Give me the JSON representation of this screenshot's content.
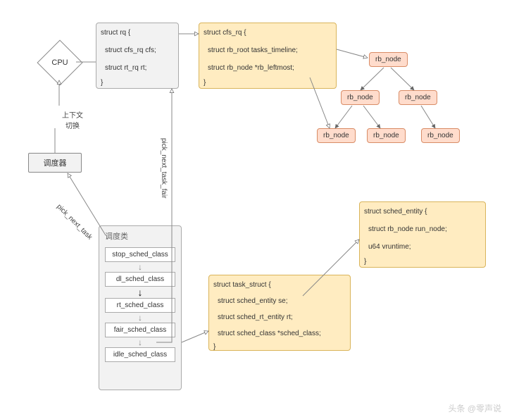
{
  "cpu": {
    "label": "CPU"
  },
  "context_switch": "上下文\n切换",
  "scheduler": {
    "label": "调度器"
  },
  "rq": {
    "open": "struct rq {",
    "l1": "struct cfs_rq cfs;",
    "l2": "struct rt_rq rt;",
    "close": "}"
  },
  "cfs_rq": {
    "open": "struct cfs_rq {",
    "l1": "struct rb_root tasks_timeline;",
    "l2": "struct rb_node *rb_leftmost;",
    "close": "}"
  },
  "rb_nodes": {
    "n1": "rb_node",
    "n2": "rb_node",
    "n3": "rb_node",
    "n4": "rb_node",
    "n5": "rb_node",
    "n6": "rb_node"
  },
  "sched_entity": {
    "open": "struct sched_entity {",
    "l1": "struct rb_node run_node;",
    "l2": "u64 vruntime;",
    "close": "}"
  },
  "task_struct": {
    "open": "struct task_struct {",
    "l1": "struct sched_entity se;",
    "l2": "struct sched_rt_entity rt;",
    "l3": "struct sched_class *sched_class;",
    "close": "}"
  },
  "sched_classes": {
    "title": "调度类",
    "items": {
      "stop": "stop_sched_class",
      "dl": "dl_sched_class",
      "rt": "rt_sched_class",
      "fair": "fair_sched_class",
      "idle": "idle_sched_class"
    }
  },
  "edge_labels": {
    "pick_next_task": "pick_next_task",
    "pick_next_task_fair": "pick_next_task_fair"
  },
  "watermark": "头条 @零声说"
}
